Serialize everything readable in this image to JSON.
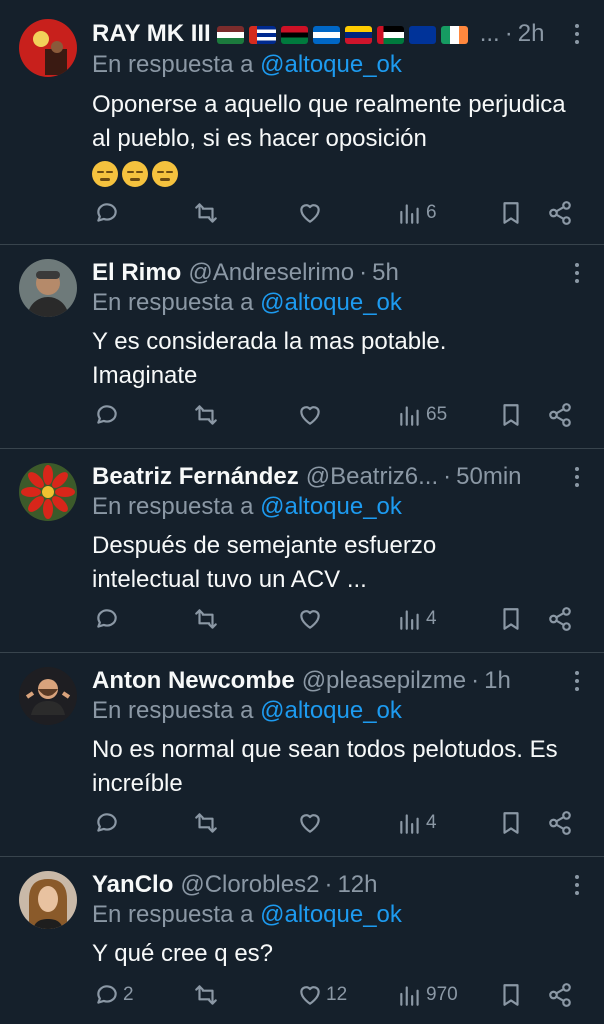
{
  "reply_prefix": "En respuesta a",
  "reply_to": "@altoque_ok",
  "colors": {
    "background": "#15202b",
    "muted": "#8b98a5",
    "accent": "#1d9bf0",
    "divider": "#38444d"
  },
  "tweets": [
    {
      "name": "RAY MK III",
      "flags_suffix": "...",
      "handle": "",
      "time": "2h",
      "text": "Oponerse a aquello que realmente perjudica al pueblo, si es hacer oposición",
      "emojis": 3,
      "replies": "",
      "reposts": "",
      "likes": "",
      "views": "6"
    },
    {
      "name": "El Rimo",
      "handle": "@Andreselrimo",
      "time": "5h",
      "text": "Y es considerada la mas potable. Imaginate",
      "replies": "",
      "reposts": "",
      "likes": "",
      "views": "65"
    },
    {
      "name": "Beatriz Fernández",
      "handle": "@Beatriz6...",
      "time": "50min",
      "text": "Después de semejante esfuerzo intelectual tuvo un ACV ...",
      "replies": "",
      "reposts": "",
      "likes": "",
      "views": "4"
    },
    {
      "name": "Anton Newcombe",
      "handle": "@pleasepilzme",
      "time": "1h",
      "text": "No es normal que sean todos pelotudos. Es increíble",
      "replies": "",
      "reposts": "",
      "likes": "",
      "views": "4"
    },
    {
      "name": "YanClo",
      "handle": "@Clorobles2",
      "time": "12h",
      "text": "Y qué cree q es?",
      "replies": "2",
      "reposts": "",
      "likes": "12",
      "views": "970"
    }
  ]
}
